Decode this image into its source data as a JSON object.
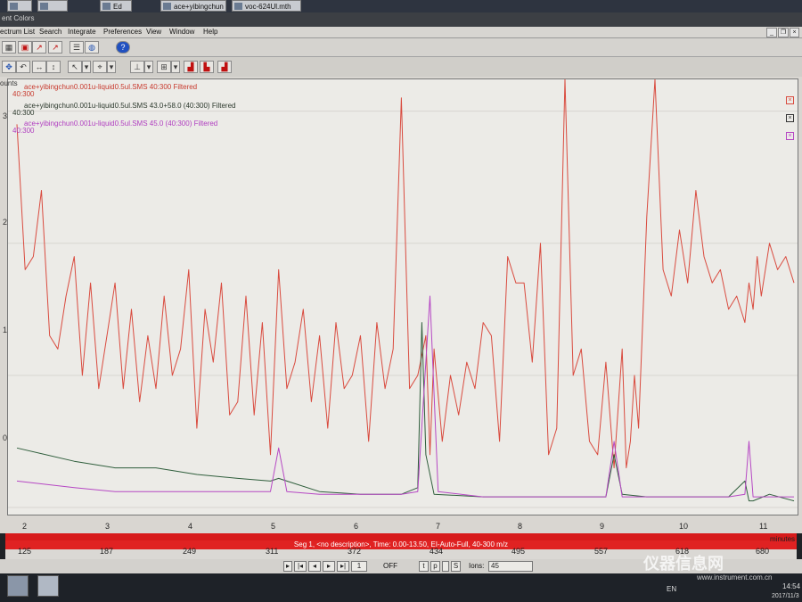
{
  "taskbar_top": {
    "items": [
      {
        "label": "Ed"
      },
      {
        "label": "ace+yibingchun"
      },
      {
        "label": "voc-624Ul.mth"
      }
    ]
  },
  "window": {
    "title": "ent Colors"
  },
  "menu": {
    "items": [
      "ectrum List",
      "Search",
      "Integrate",
      "Preferences",
      "View",
      "Window",
      "Help"
    ]
  },
  "chart": {
    "y_axis_label": "ounts",
    "y_ticks": [
      "3",
      "2",
      "1",
      "0"
    ],
    "x_ticks": [
      "2",
      "3",
      "4",
      "5",
      "6",
      "7",
      "8",
      "9",
      "10",
      "11"
    ],
    "x_unit": "minutes",
    "traces": [
      {
        "label": "ace+yibingchun0.001u-liquid0.5ul.SMS 40:300 Filtered",
        "range": "40:300",
        "color": "#d94b3f"
      },
      {
        "label": "ace+yibingchun0.001u-liquid0.5ul.SMS 43.0+58.0 (40:300) Filtered",
        "range": "40:300",
        "color": "#2f5e3c"
      },
      {
        "label": "ace+yibingchun0.001u-liquid0.5ul.SMS 45.0 (40:300) Filtered",
        "range": "40:300",
        "color": "#b648c4"
      }
    ]
  },
  "segment": {
    "text": "Seg 1, <no description>, Time: 0.00-13.50, EI-Auto-Full, 40-300 m/z"
  },
  "scan_ticks": [
    "125",
    "187",
    "249",
    "311",
    "372",
    "434",
    "495",
    "557",
    "618",
    "680"
  ],
  "controls": {
    "mode": "OFF",
    "t": "t",
    "p": "p",
    "s": "S",
    "ions_label": "Ions:",
    "ions_value": "45"
  },
  "system_tray": {
    "lang": "EN",
    "time": "14:54",
    "date": "2017/11/3"
  },
  "watermark": {
    "text": "仪器信息网",
    "url": "www.instrument.com.cn"
  },
  "chart_data": {
    "type": "line",
    "xlabel": "minutes",
    "ylabel": "ounts",
    "xlim": [
      1.8,
      11.3
    ],
    "ylim": [
      0,
      3.2
    ],
    "series": [
      {
        "name": "ace+yibingchun0.001u-liquid0.5ul.SMS 40:300 Filtered",
        "x": [
          1.8,
          1.9,
          2.0,
          2.1,
          2.2,
          2.3,
          2.4,
          2.5,
          2.6,
          2.7,
          2.8,
          2.9,
          3.0,
          3.1,
          3.2,
          3.3,
          3.4,
          3.5,
          3.6,
          3.7,
          3.8,
          3.9,
          4.0,
          4.1,
          4.2,
          4.3,
          4.4,
          4.5,
          4.6,
          4.7,
          4.8,
          4.9,
          5.0,
          5.1,
          5.2,
          5.3,
          5.4,
          5.5,
          5.6,
          5.7,
          5.8,
          5.9,
          6.0,
          6.1,
          6.2,
          6.3,
          6.4,
          6.5,
          6.6,
          6.7,
          6.8,
          6.85,
          6.9,
          7.0,
          7.1,
          7.2,
          7.3,
          7.4,
          7.5,
          7.6,
          7.7,
          7.8,
          7.9,
          8.0,
          8.1,
          8.2,
          8.3,
          8.4,
          8.5,
          8.6,
          8.7,
          8.8,
          8.9,
          9.0,
          9.1,
          9.2,
          9.25,
          9.3,
          9.35,
          9.4,
          9.5,
          9.6,
          9.7,
          9.8,
          9.9,
          10.0,
          10.1,
          10.2,
          10.3,
          10.4,
          10.5,
          10.6,
          10.7,
          10.75,
          10.8,
          10.85,
          10.9,
          11.0,
          11.1,
          11.2,
          11.3
        ],
        "y": [
          2.9,
          1.8,
          1.9,
          2.4,
          1.3,
          1.2,
          1.6,
          1.9,
          1.0,
          1.7,
          0.9,
          1.3,
          1.7,
          0.9,
          1.5,
          0.8,
          1.3,
          0.9,
          1.6,
          1.0,
          1.2,
          1.8,
          0.6,
          1.5,
          1.1,
          1.7,
          0.7,
          0.8,
          1.6,
          0.7,
          1.4,
          0.4,
          1.8,
          0.9,
          1.1,
          1.5,
          0.8,
          1.3,
          0.6,
          1.4,
          0.9,
          1.0,
          1.3,
          0.5,
          1.4,
          0.9,
          1.2,
          3.1,
          0.9,
          1.0,
          1.3,
          0.4,
          1.2,
          0.5,
          1.0,
          0.7,
          1.1,
          0.9,
          1.4,
          1.3,
          0.5,
          1.9,
          1.7,
          1.7,
          1.1,
          2.0,
          0.4,
          0.6,
          3.6,
          1.0,
          1.2,
          0.5,
          0.4,
          1.1,
          0.3,
          1.2,
          0.3,
          0.5,
          1.0,
          0.6,
          2.2,
          3.5,
          1.8,
          1.6,
          2.1,
          1.7,
          2.4,
          1.9,
          1.7,
          1.8,
          1.5,
          1.6,
          1.4,
          1.7,
          1.5,
          1.9,
          1.6,
          2.0,
          1.8,
          1.9,
          1.7
        ]
      },
      {
        "name": "ace+yibingchun0.001u-liquid0.5ul.SMS 43.0+58.0 (40:300) Filtered",
        "x": [
          1.8,
          2.5,
          3.0,
          3.5,
          4.0,
          4.5,
          4.9,
          5.0,
          5.1,
          5.5,
          6.0,
          6.5,
          6.7,
          6.75,
          6.8,
          6.9,
          7.5,
          8.0,
          8.5,
          9.0,
          9.1,
          9.2,
          9.5,
          10.0,
          10.5,
          10.7,
          10.75,
          10.8,
          11.0,
          11.3
        ],
        "y": [
          0.45,
          0.35,
          0.3,
          0.3,
          0.25,
          0.22,
          0.2,
          0.22,
          0.2,
          0.12,
          0.1,
          0.1,
          0.15,
          1.4,
          0.4,
          0.1,
          0.08,
          0.08,
          0.08,
          0.08,
          0.4,
          0.1,
          0.08,
          0.08,
          0.08,
          0.2,
          0.05,
          0.05,
          0.1,
          0.05
        ]
      },
      {
        "name": "ace+yibingchun0.001u-liquid0.5ul.SMS 45.0 (40:300) Filtered",
        "x": [
          1.8,
          2.5,
          3.0,
          3.5,
          4.0,
          4.5,
          4.9,
          5.0,
          5.1,
          5.5,
          6.0,
          6.5,
          6.7,
          6.85,
          6.95,
          7.5,
          8.0,
          8.5,
          9.0,
          9.1,
          9.2,
          9.5,
          10.0,
          10.5,
          10.7,
          10.75,
          10.8,
          11.0,
          11.3
        ],
        "y": [
          0.2,
          0.15,
          0.12,
          0.12,
          0.12,
          0.12,
          0.12,
          0.45,
          0.12,
          0.1,
          0.1,
          0.1,
          0.12,
          1.6,
          0.12,
          0.08,
          0.08,
          0.08,
          0.08,
          0.5,
          0.08,
          0.08,
          0.08,
          0.08,
          0.1,
          0.5,
          0.08,
          0.08,
          0.08
        ]
      }
    ]
  }
}
